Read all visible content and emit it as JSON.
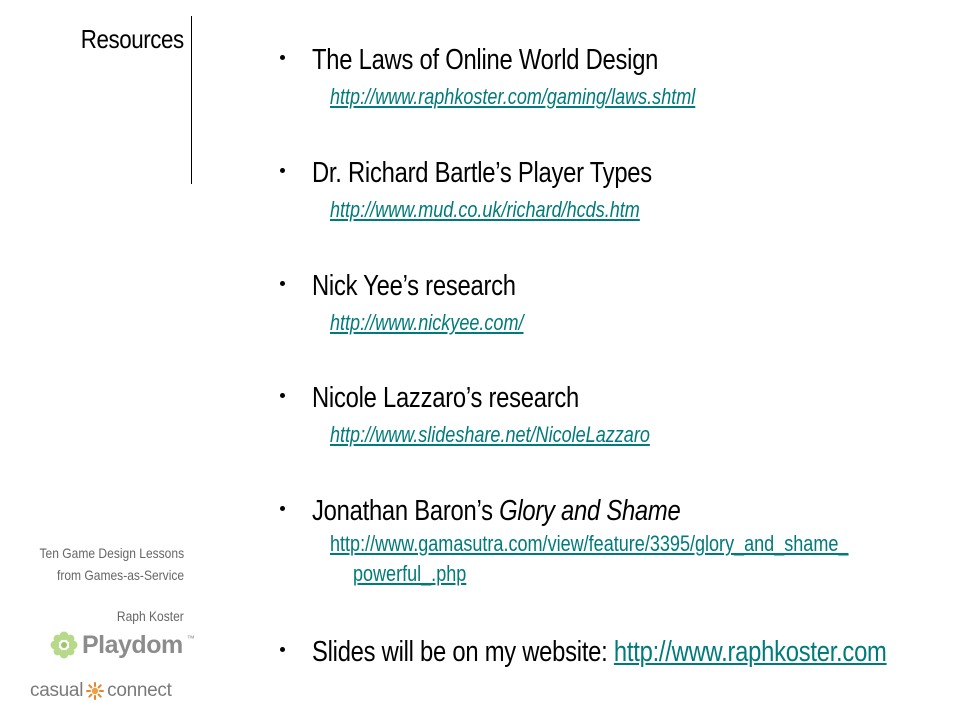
{
  "sidebar": {
    "section_title": "Resources",
    "talk_title_line1": "Ten Game Design Lessons",
    "talk_title_line2": "from Games-as-Service",
    "speaker": "Raph Koster",
    "playdom_logo_text": "Playdom",
    "playdom_logo_mark": "™",
    "casual_logo_left": "casual",
    "casual_logo_right": "connect"
  },
  "resources": [
    {
      "title": "The Laws of Online World Design",
      "url": "http://www.raphkoster.com/gaming/laws.shtml"
    },
    {
      "title": "Dr. Richard Bartle’s Player Types",
      "url": "http://www.mud.co.uk/richard/hcds.htm"
    },
    {
      "title": "Nick Yee’s research",
      "url": "http://www.nickyee.com/"
    },
    {
      "title": "Nicole Lazzaro’s research",
      "url": "http://www.slideshare.net/NicoleLazzaro"
    },
    {
      "title_prefix": "Jonathan Baron’s ",
      "title_emph": "Glory and Shame",
      "url_line1": "http://www.gamasutra.com/view/feature/3395/glory_and_shame_",
      "url_line2": "powerful_.php"
    }
  ],
  "footer_note": {
    "text": "Slides will be on my website: ",
    "url": "http://www.raphkoster.com"
  },
  "colors": {
    "link": "#007a7a",
    "muted": "#666666"
  }
}
